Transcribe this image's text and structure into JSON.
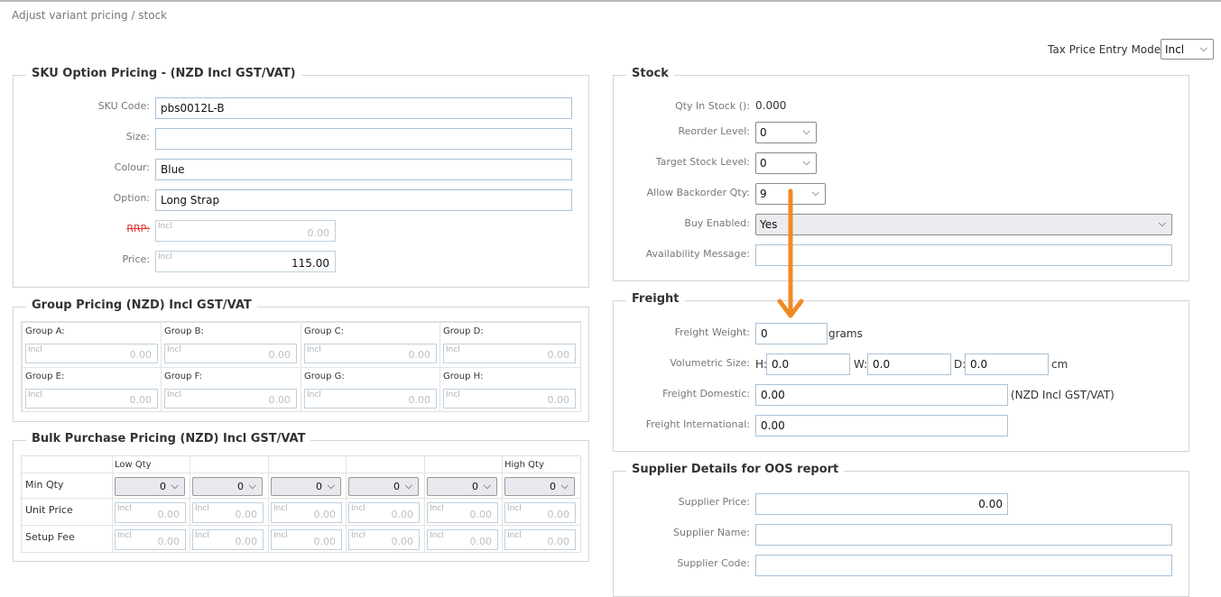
{
  "page_title": "Adjust variant pricing / stock",
  "tax_mode": {
    "label": "Tax Price Entry Mode:",
    "value": "Incl"
  },
  "sku_pricing": {
    "title": "SKU Option Pricing - (NZD Incl GST/VAT)",
    "sku_code_label": "SKU Code:",
    "sku_code": "pbs0012L-B",
    "size_label": "Size:",
    "size": "",
    "colour_label": "Colour:",
    "colour": "Blue",
    "option_label": "Option:",
    "option": "Long Strap",
    "rrp_label": "RRP:",
    "rrp_tag": "Incl",
    "rrp": "0.00",
    "price_label": "Price:",
    "price_tag": "Incl",
    "price": "115.00"
  },
  "group_pricing": {
    "title": "Group Pricing (NZD) Incl GST/VAT",
    "groups": [
      {
        "label": "Group A:",
        "tag": "Incl",
        "value": "0.00"
      },
      {
        "label": "Group B:",
        "tag": "Incl",
        "value": "0.00"
      },
      {
        "label": "Group C:",
        "tag": "Incl",
        "value": "0.00"
      },
      {
        "label": "Group D:",
        "tag": "Incl",
        "value": "0.00"
      },
      {
        "label": "Group E:",
        "tag": "Incl",
        "value": "0.00"
      },
      {
        "label": "Group F:",
        "tag": "Incl",
        "value": "0.00"
      },
      {
        "label": "Group G:",
        "tag": "Incl",
        "value": "0.00"
      },
      {
        "label": "Group H:",
        "tag": "Incl",
        "value": "0.00"
      }
    ]
  },
  "bulk_pricing": {
    "title": "Bulk Purchase Pricing (NZD) Incl GST/VAT",
    "low_qty": "Low Qty",
    "high_qty": "High Qty",
    "rows": [
      "Min Qty",
      "Unit Price",
      "Setup Fee"
    ],
    "min_qty": [
      "0",
      "0",
      "0",
      "0",
      "0",
      "0"
    ],
    "tag": "Incl",
    "value": "0.00"
  },
  "stock": {
    "title": "Stock",
    "qty_label": "Qty In Stock ():",
    "qty": "0.000",
    "reorder_label": "Reorder Level:",
    "reorder": "0",
    "target_label": "Target Stock Level:",
    "target": "0",
    "backorder_label": "Allow Backorder Qty:",
    "backorder": "9",
    "buy_label": "Buy Enabled:",
    "buy": "Yes",
    "avail_label": "Availability Message:",
    "avail": ""
  },
  "freight": {
    "title": "Freight",
    "weight_label": "Freight Weight:",
    "weight": "0",
    "weight_unit": "grams",
    "vol_label": "Volumetric Size:",
    "h_label": "H:",
    "h": "0.0",
    "w_label": "W:",
    "w": "0.0",
    "d_label": "D:",
    "d": "0.0",
    "vol_unit": "cm",
    "domestic_label": "Freight Domestic:",
    "domestic": "0.00",
    "domestic_note": "(NZD Incl GST/VAT)",
    "intl_label": "Freight International:",
    "intl": "0.00"
  },
  "supplier": {
    "title": "Supplier Details for OOS report",
    "price_label": "Supplier Price:",
    "price": "0.00",
    "name_label": "Supplier Name:",
    "name": "",
    "code_label": "Supplier Code:",
    "code": ""
  },
  "colors": {
    "arrow": "#f08a24",
    "input_border": "#a9c1d6"
  }
}
